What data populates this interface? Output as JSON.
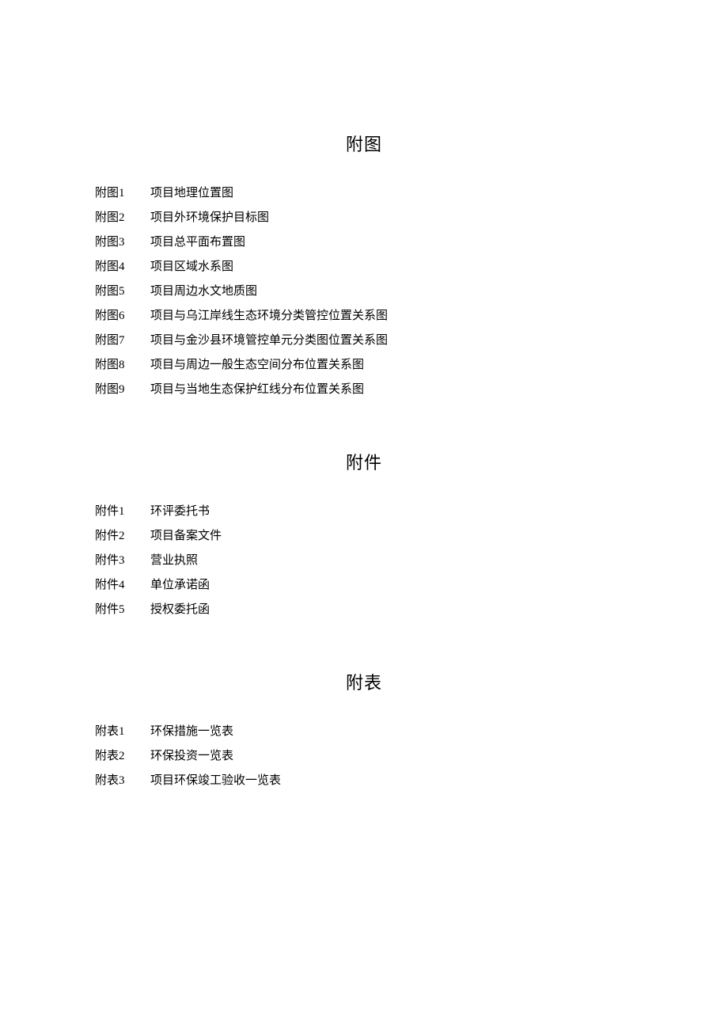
{
  "sections": [
    {
      "title": "附图",
      "items": [
        {
          "label": "附图1",
          "desc": "项目地理位置图"
        },
        {
          "label": "附图2",
          "desc": "项目外环境保护目标图"
        },
        {
          "label": "附图3",
          "desc": "项目总平面布置图"
        },
        {
          "label": "附图4",
          "desc": "项目区域水系图"
        },
        {
          "label": "附图5",
          "desc": "项目周边水文地质图"
        },
        {
          "label": "附图6",
          "desc": "项目与乌江岸线生态环境分类管控位置关系图"
        },
        {
          "label": "附图7",
          "desc": "项目与金沙县环境管控单元分类图位置关系图"
        },
        {
          "label": "附图8",
          "desc": "项目与周边一般生态空间分布位置关系图"
        },
        {
          "label": "附图9",
          "desc": "项目与当地生态保护红线分布位置关系图"
        }
      ]
    },
    {
      "title": "附件",
      "items": [
        {
          "label": "附件1",
          "desc": "环评委托书"
        },
        {
          "label": "附件2",
          "desc": "项目备案文件"
        },
        {
          "label": "附件3",
          "desc": "营业执照"
        },
        {
          "label": "附件4",
          "desc": "单位承诺函"
        },
        {
          "label": "附件5",
          "desc": "授权委托函"
        }
      ]
    },
    {
      "title": "附表",
      "items": [
        {
          "label": "附表1",
          "desc": "环保措施一览表"
        },
        {
          "label": "附表2",
          "desc": "环保投资一览表"
        },
        {
          "label": "附表3",
          "desc": "项目环保竣工验收一览表"
        }
      ]
    }
  ]
}
